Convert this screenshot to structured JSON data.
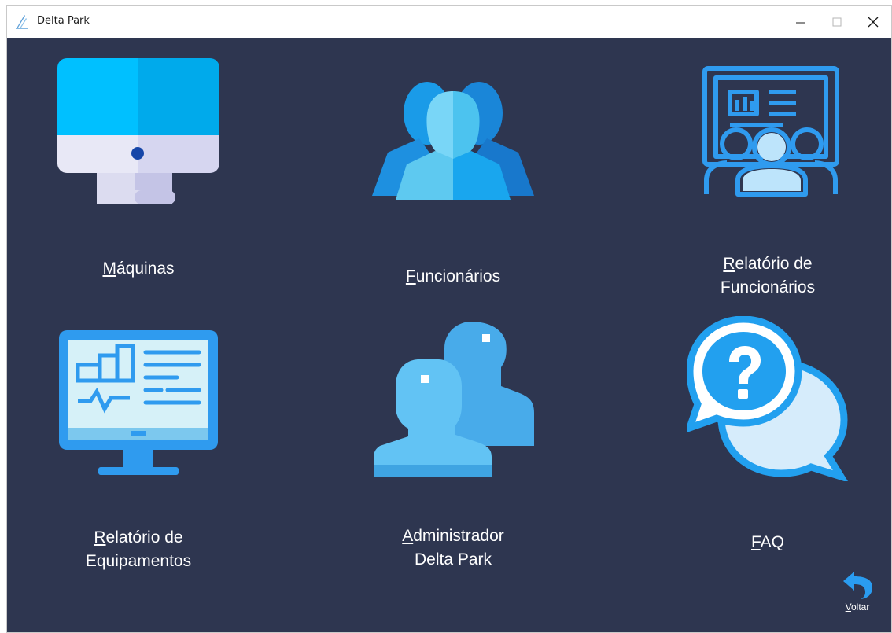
{
  "window": {
    "title": "Delta Park"
  },
  "tiles": [
    {
      "id": "maquinas",
      "underline": "M",
      "rest": "áquinas"
    },
    {
      "id": "funcionarios",
      "underline": "F",
      "rest": "uncionários"
    },
    {
      "id": "relatorio-funcionarios",
      "underline": "R",
      "rest": "elatório de\nFuncionários"
    },
    {
      "id": "relatorio-equipamentos",
      "underline": "R",
      "rest": "elatório de\nEquipamentos"
    },
    {
      "id": "administrador",
      "underline": "A",
      "rest": "dministrador\nDelta Park"
    },
    {
      "id": "faq",
      "underline": "F",
      "rest": "AQ"
    }
  ],
  "voltar": {
    "underline": "V",
    "rest": "oltar"
  },
  "colors": {
    "background": "#2e3650",
    "accent": "#29a9f0",
    "text": "#ffffff"
  },
  "icons": {
    "maquinas": "desktop-monitor-icon",
    "funcionarios": "people-group-icon",
    "relatorio_funcionarios": "presentation-board-icon",
    "relatorio_equipamentos": "monitor-report-icon",
    "administrador": "admin-users-icon",
    "faq": "question-chat-icon",
    "voltar": "undo-arrow-icon"
  }
}
